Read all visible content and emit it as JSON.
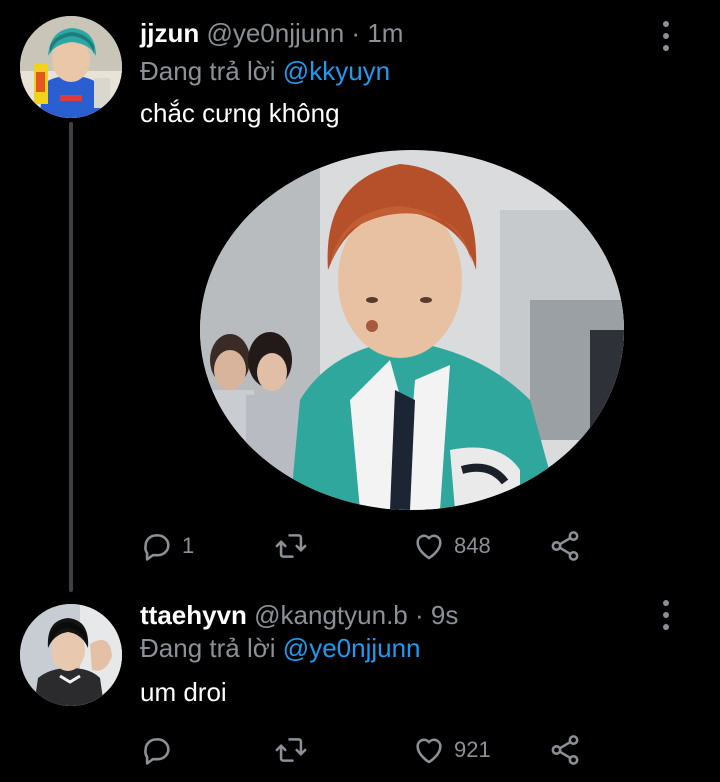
{
  "tweets": [
    {
      "display_name": "jjzun",
      "handle": "@ye0njjunn",
      "time": "1m",
      "replying_prefix": "Đang trả lời",
      "replying_to": "@kkyuyn",
      "text": "chắc cưng không",
      "reply_count": "1",
      "retweet_count": "",
      "like_count": "848",
      "has_media": true
    },
    {
      "display_name": "ttaehyvn",
      "handle": "@kangtyun.b",
      "time": "9s",
      "replying_prefix": "Đang trả lời",
      "replying_to": "@ye0njjunn",
      "text": "um droi",
      "reply_count": "",
      "retweet_count": "",
      "like_count": "921",
      "has_media": false
    }
  ],
  "icons": {
    "reply": "comment-bubble-icon",
    "retweet": "retweet-icon",
    "like": "heart-icon",
    "share": "share-icon",
    "more": "more-vertical-icon"
  },
  "colors": {
    "background": "#000000",
    "secondary_text": "#8b9197",
    "mention": "#1d9bf0",
    "thread_line": "#3d4044"
  }
}
